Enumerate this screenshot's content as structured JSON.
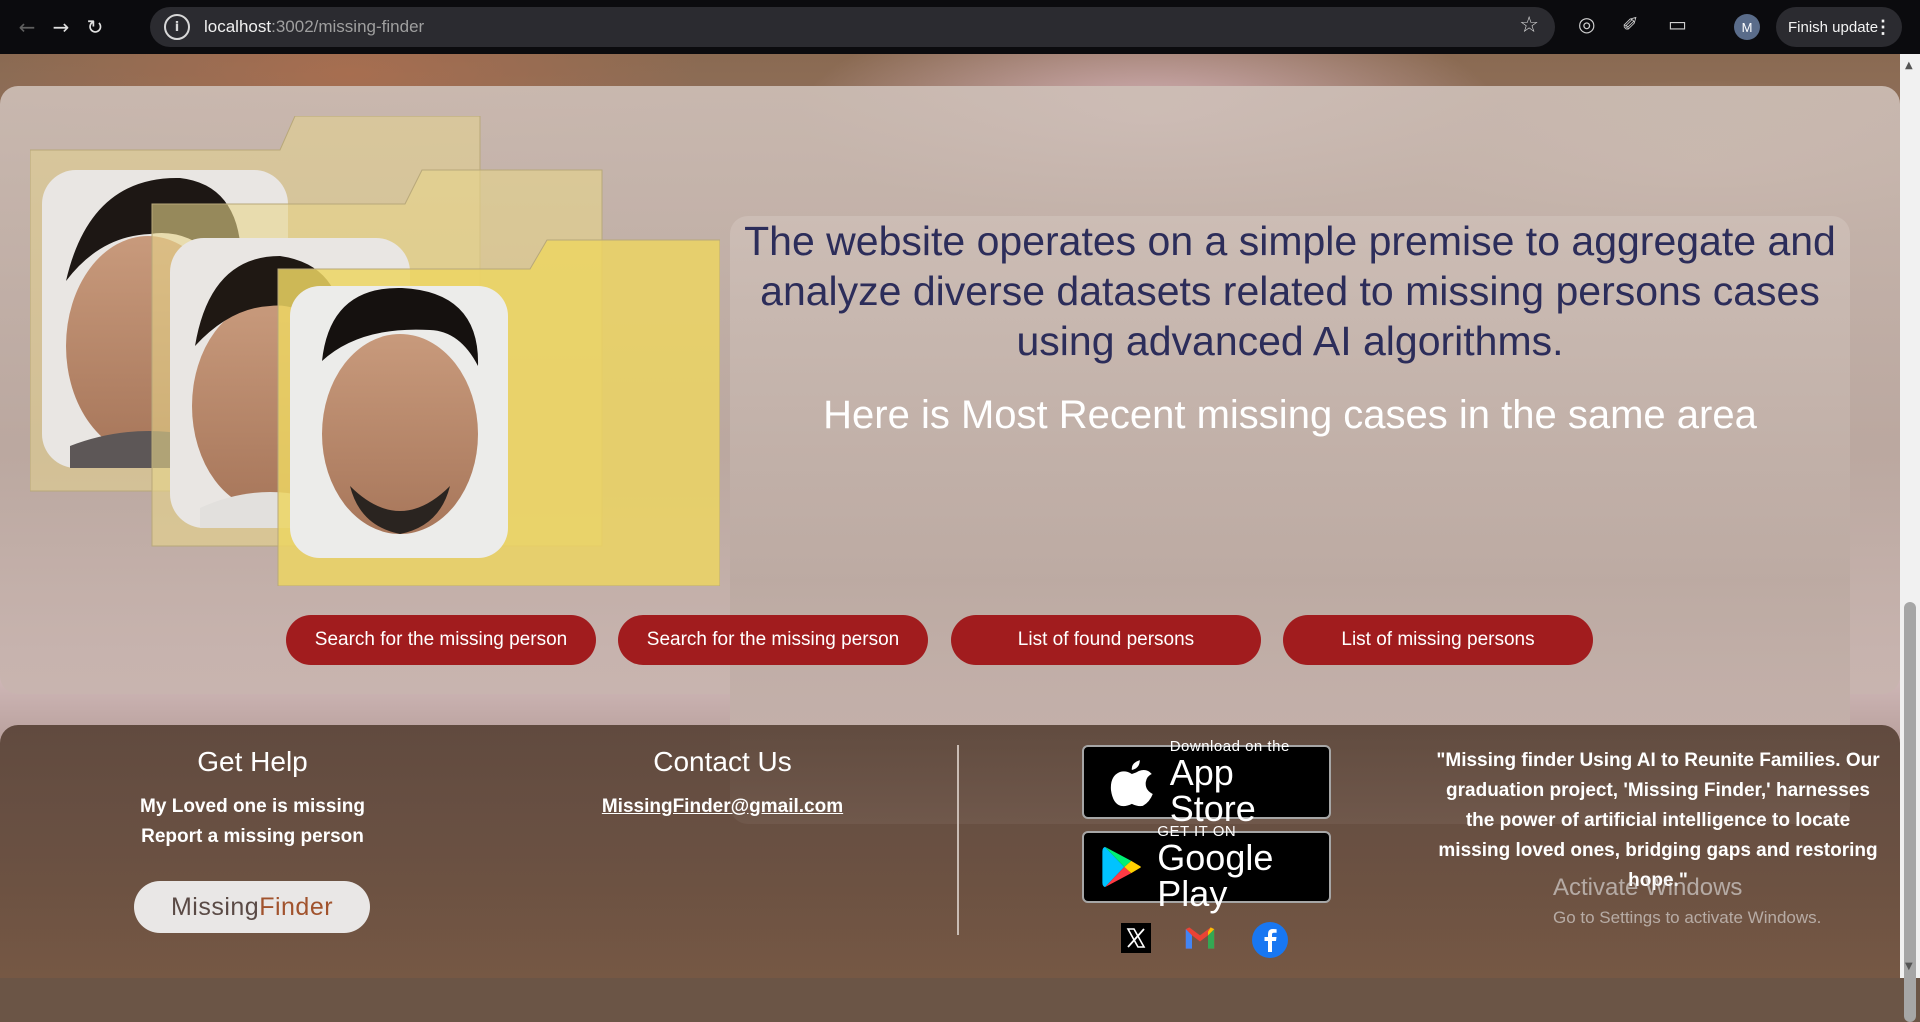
{
  "browser": {
    "url_host": "localhost",
    "url_path": ":3002/missing-finder",
    "profile_initial": "M",
    "finish_update_label": "Finish update"
  },
  "hero": {
    "headline": "The website operates on a simple premise to aggregate and analyze diverse datasets related to missing persons cases using advanced AI algorithms.",
    "subheadline": "Here is Most Recent missing cases in the same area",
    "buttons": [
      {
        "label": "Search for the missing person"
      },
      {
        "label": "Search for the missing person"
      },
      {
        "label": "List of found persons"
      },
      {
        "label": "List of missing persons"
      }
    ]
  },
  "footer": {
    "get_help": {
      "title": "Get Help",
      "links": [
        "My Loved one is missing",
        "Report a missing person"
      ]
    },
    "contact": {
      "title": "Contact Us",
      "email": "MissingFinder@gmail.com"
    },
    "logo": {
      "text_start": "Missing ",
      "text_accent": "Finder"
    },
    "app_store": {
      "small": "Download on the",
      "big": "App Store"
    },
    "google_play": {
      "small": "GET IT ON",
      "big": "Google Play"
    },
    "social": [
      "x-icon",
      "gmail-icon",
      "facebook-icon"
    ],
    "quote": "\"Missing finder Using AI to Reunite Families. Our graduation project, 'Missing Finder,' harnesses the power of artificial intelligence to locate missing loved ones, bridging gaps and restoring hope.\""
  },
  "os_overlay": {
    "title": "Activate Windows",
    "subtitle": "Go to Settings to activate Windows."
  }
}
